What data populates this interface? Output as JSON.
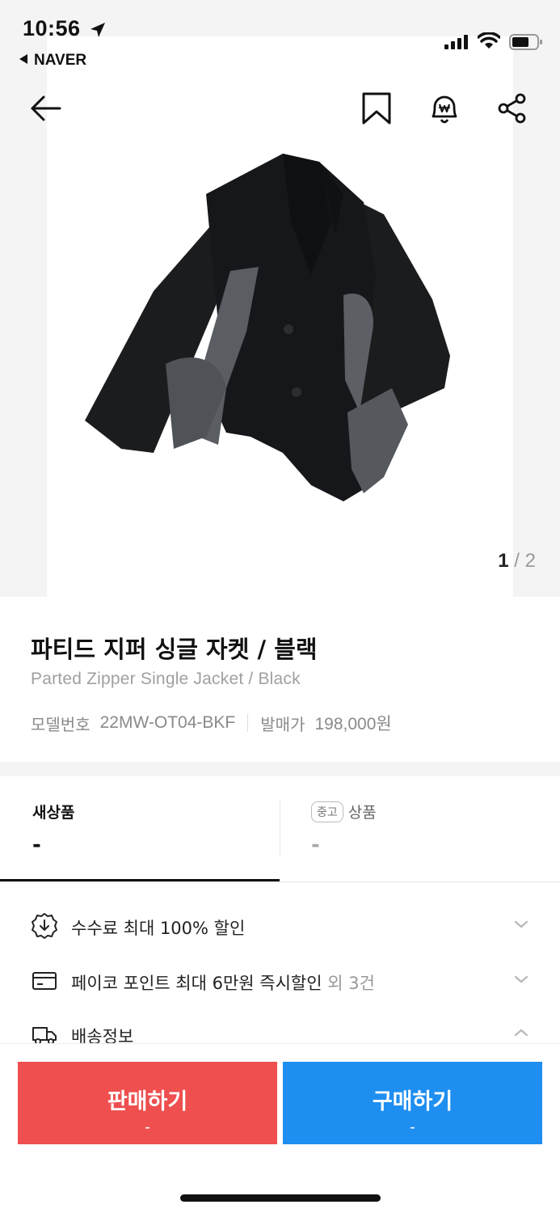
{
  "status_bar": {
    "time": "10:56",
    "back_app": "NAVER"
  },
  "icons": {
    "back": "arrow-left-icon",
    "bookmark": "bookmark-icon",
    "price_alert": "won-bell-icon",
    "share": "share-icon",
    "location": "location-arrow-icon",
    "signal": "cellular-signal-icon",
    "wifi": "wifi-icon",
    "battery": "battery-icon",
    "fee": "discount-badge-icon",
    "pay": "card-icon",
    "shipping": "truck-icon"
  },
  "gallery": {
    "current": "1",
    "separator": " / ",
    "total": "2"
  },
  "product": {
    "title": "파티드 지퍼 싱글 자켓 / 블랙",
    "subtitle": "Parted Zipper Single Jacket / Black",
    "model_label": "모델번호",
    "model_value": "22MW-OT04-BKF",
    "release_label": "발매가",
    "release_value": "198,000원"
  },
  "tabs": {
    "new_label": "새상품",
    "new_value": "-",
    "used_tag": "중고",
    "used_label": "상품",
    "used_value": "-",
    "active": "new"
  },
  "benefits": {
    "fee_text": "수수료 최대 100% 할인",
    "pay_text": "페이코 포인트 최대 6만원 즉시할인",
    "pay_extra": " 외 3건",
    "shipping_text": "배송정보"
  },
  "actions": {
    "sell_label": "판매하기",
    "sell_price": "-",
    "buy_label": "구매하기",
    "buy_price": "-"
  },
  "colors": {
    "sell": "#ef4f4f",
    "buy": "#1e8ef0",
    "text": "#222222"
  }
}
